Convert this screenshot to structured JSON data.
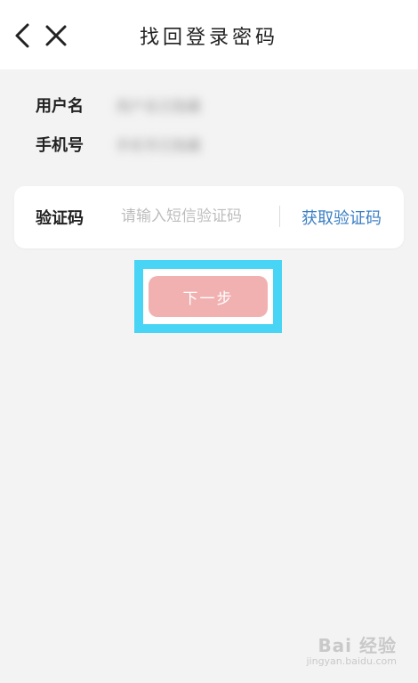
{
  "header": {
    "title": "找回登录密码",
    "back_icon": "chevron-left-icon",
    "close_icon": "close-icon"
  },
  "info": {
    "username_label": "用户名",
    "username_value": "用户名已隐藏",
    "phone_label": "手机号",
    "phone_value": "手机号已隐藏"
  },
  "verification": {
    "label": "验证码",
    "placeholder": "请输入短信验证码",
    "get_code_label": "获取验证码"
  },
  "next_button": {
    "label": "下一步"
  },
  "watermark": {
    "logo": "Bai 经验",
    "url": "jingyan.baidu.com"
  },
  "colors": {
    "accent_link": "#3b7fc4",
    "button_disabled": "#f2b1b1",
    "highlight": "#48d4f5",
    "background": "#f3f3f3"
  }
}
